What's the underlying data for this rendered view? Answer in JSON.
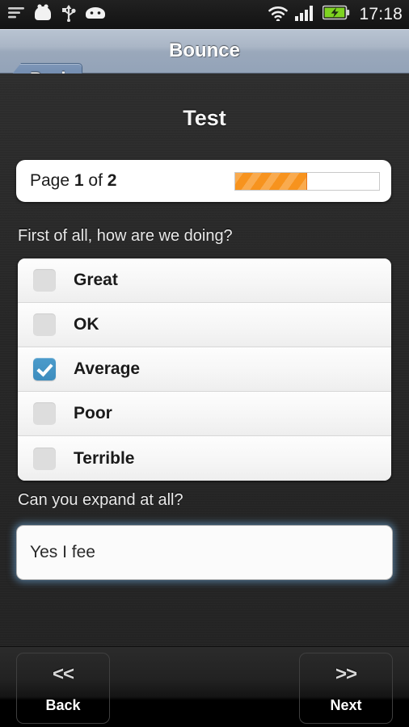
{
  "status_bar": {
    "time": "17:18",
    "left_icons": [
      {
        "name": "list-lines-icon",
        "label": "notifications"
      },
      {
        "name": "android-robot-icon",
        "label": "app"
      },
      {
        "name": "usb-icon",
        "label": "usb connected"
      },
      {
        "name": "android-head-icon",
        "label": "debug"
      }
    ],
    "right_icons": [
      {
        "name": "wifi-icon",
        "label": "wifi"
      },
      {
        "name": "signal-bars-icon",
        "label": "signal"
      },
      {
        "name": "battery-charging-icon",
        "label": "battery charging"
      }
    ],
    "battery_color": "#7ed321"
  },
  "title_bar": {
    "back_label": "Back",
    "title": "Bounce"
  },
  "main": {
    "heading": "Test",
    "page_prefix": "Page",
    "page_current": "1",
    "page_middle": "of",
    "page_total": "2",
    "progress_percent": 50,
    "progress_color": "#f7931e"
  },
  "questions": [
    {
      "label": "First of all, how are we doing?",
      "type": "checkbox-list",
      "options": [
        {
          "label": "Great",
          "checked": false
        },
        {
          "label": "OK",
          "checked": false
        },
        {
          "label": "Average",
          "checked": true
        },
        {
          "label": "Poor",
          "checked": false
        },
        {
          "label": "Terrible",
          "checked": false
        }
      ]
    },
    {
      "label": "Can you expand at all?",
      "type": "text",
      "value": "Yes I fee",
      "placeholder": ""
    }
  ],
  "bottom_nav": {
    "back_chevrons": "<<",
    "back_label": "Back",
    "next_chevrons": ">>",
    "next_label": "Next"
  },
  "colors": {
    "accent_checkbox": "#3d8dbe",
    "progress": "#f7931e",
    "background": "#272727",
    "title_bar": "#9aa8bb"
  }
}
